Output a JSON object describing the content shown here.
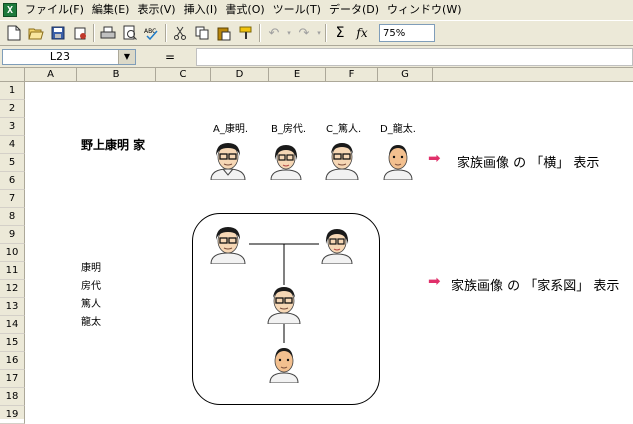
{
  "menubar": {
    "app_icon": "excel-icon",
    "items": [
      "ファイル(F)",
      "編集(E)",
      "表示(V)",
      "挿入(I)",
      "書式(O)",
      "ツール(T)",
      "データ(D)",
      "ウィンドウ(W)"
    ]
  },
  "toolbar": {
    "icons": [
      "new-icon",
      "open-icon",
      "save-icon",
      "permission-icon",
      "print-icon",
      "print-preview-icon",
      "spelling-icon",
      "cut-icon",
      "copy-icon",
      "paste-icon",
      "format-painter-icon",
      "undo-icon",
      "redo-icon",
      "autosum-icon",
      "function-icon"
    ],
    "autosum_glyph": "Σ",
    "function_glyph": "fx",
    "zoom": "75%"
  },
  "formula_bar": {
    "name_box": "L23",
    "equals": "=",
    "formula": ""
  },
  "columns": [
    "A",
    "B",
    "C",
    "D",
    "E",
    "F",
    "G"
  ],
  "rows": [
    "1",
    "2",
    "3",
    "4",
    "5",
    "6",
    "7",
    "8",
    "9",
    "10",
    "11",
    "12",
    "13",
    "14",
    "15",
    "16",
    "17",
    "18",
    "19"
  ],
  "sheet": {
    "title": "野上康明 家",
    "portrait_labels": [
      "A_康明.",
      "B_房代.",
      "C_篤人.",
      "D_龍太."
    ],
    "names": [
      "康明",
      "房代",
      "篤人",
      "龍太"
    ],
    "link_horizontal": "家族画像 の 「横」 表示",
    "link_tree": "家族画像 の 「家系図」 表示",
    "arrow_glyph": "➡",
    "arrow_color": "#e0306a"
  }
}
